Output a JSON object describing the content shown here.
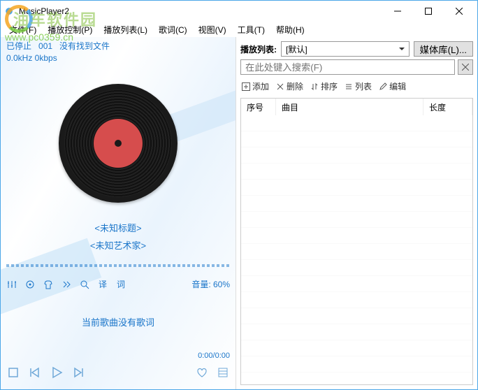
{
  "window": {
    "title": "MusicPlayer2"
  },
  "menu": {
    "file": "文件(F)",
    "play_ctrl": "播放控制(P)",
    "playlist": "播放列表(L)",
    "lyrics": "歌词(C)",
    "view": "视图(V)",
    "tools": "工具(T)",
    "help": "帮助(H)"
  },
  "status": {
    "state": "已停止",
    "index": "001",
    "message": "没有找到文件",
    "bitrate": "0.0kHz 0kbps"
  },
  "track": {
    "title": "<未知标题>",
    "artist": "<未知艺术家>"
  },
  "tool_labels": {
    "translate": "译",
    "lyric": "词",
    "volume": "音量: 60%"
  },
  "lyric_area": {
    "text": "当前歌曲没有歌词"
  },
  "time": {
    "display": "0:00/0:00"
  },
  "playlist_panel": {
    "label": "播放列表:",
    "selected": "[默认]",
    "library_button": "媒体库(L)...",
    "search_placeholder": "在此处键入搜索(F)",
    "toolbar": {
      "add": "添加",
      "delete": "删除",
      "sort": "排序",
      "list": "列表",
      "edit": "编辑"
    },
    "columns": {
      "seq": "序号",
      "track": "曲目",
      "length": "长度"
    }
  },
  "watermark": {
    "text": "油车软件园",
    "url": "www.pc0359.cn"
  }
}
